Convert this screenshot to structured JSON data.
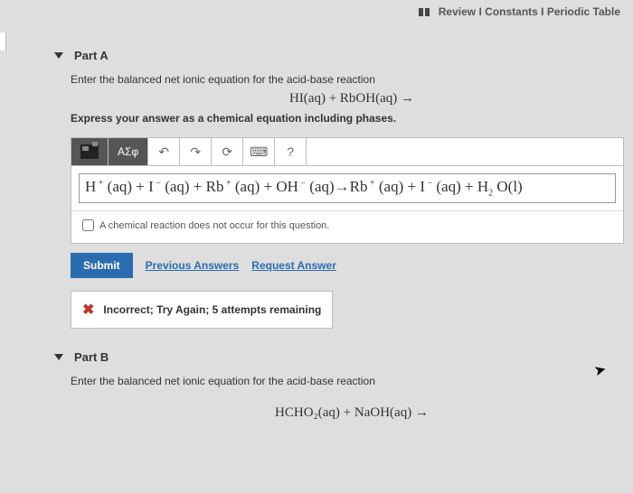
{
  "topLinks": {
    "review": "Review",
    "constants": "Constants",
    "periodic": "Periodic Table",
    "sep": "I"
  },
  "partA": {
    "title": "Part A",
    "prompt": "Enter the balanced net ionic equation for the acid-base reaction",
    "equation": "HI(aq)  +  RbOH(aq) →",
    "instruction": "Express your answer as a chemical equation including phases.",
    "toolbar": {
      "greek": "ΑΣφ",
      "help": "?"
    },
    "answer_html": "H<sup> +</sup> (aq) + I<sup> −</sup> (aq) + Rb<sup> +</sup> (aq) + OH<sup> −</sup> (aq)→Rb<sup> +</sup> (aq) + I<sup> −</sup> (aq) + H<sub>2</sub> O(l)",
    "checkbox_label": "A chemical reaction does not occur for this question.",
    "submit": "Submit",
    "prev": "Previous Answers",
    "request": "Request Answer",
    "feedback": "Incorrect; Try Again; 5 attempts remaining"
  },
  "partB": {
    "title": "Part B",
    "prompt": "Enter the balanced net ionic equation for the acid-base reaction",
    "equation": "HCHO₂(aq)  +  NaOH(aq) →"
  }
}
